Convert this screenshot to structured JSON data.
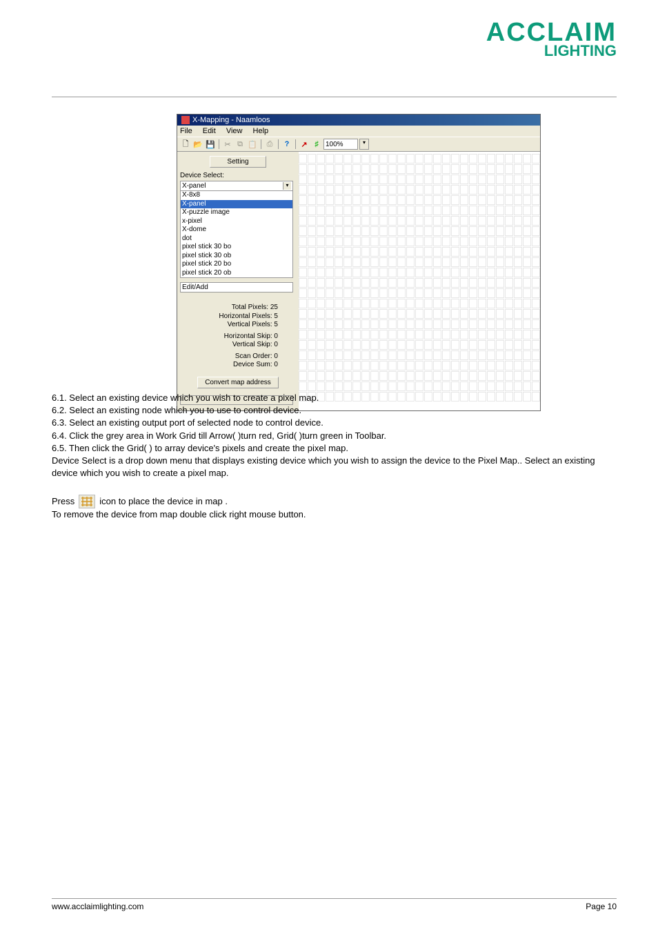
{
  "brand": {
    "name": "ACCLAIM",
    "sub": "LIGHTING"
  },
  "window": {
    "title": "X-Mapping - Naamloos",
    "menu": {
      "file": "File",
      "edit": "Edit",
      "view": "View",
      "help": "Help"
    },
    "toolbar": {
      "zoom": "100%"
    },
    "leftpanel": {
      "setting": "Setting",
      "deviceSelectLabel": "Device Select:",
      "selected": "X-panel",
      "devices": [
        "X-8x8",
        "X-panel",
        "X-puzzle image",
        "x-pixel",
        "X-dome",
        "dot",
        "pixel stick 30 bo",
        "pixel stick 30 ob",
        "pixel stick 20 bo",
        "pixel stick 20 ob"
      ],
      "editAdd": "Edit/Add",
      "stats": {
        "totalPixels": "Total Pixels: 25",
        "horizontalPixels": "Horizontal Pixels: 5",
        "verticalPixels": "Vertical Pixels: 5",
        "horizontalSkip": "Horizontal Skip: 0",
        "verticalSkip": "Vertical Skip: 0",
        "scanOrder": "Scan Order: 0",
        "deviceSum": "Device Sum: 0"
      },
      "convert": "Convert map address"
    }
  },
  "instructions": {
    "l1": "6.1. Select an existing device which you wish to create a pixel map.",
    "l2": "6.2. Select an existing node which you to use to control device.",
    "l3": "6.3. Select an existing output port of selected node to control device.",
    "l4": "6.4. Click the grey area in Work Grid till Arrow( )turn red, Grid( )turn green in Toolbar.",
    "l5": "6.5. Then click the Grid( ) to array device's pixels and create the pixel map.",
    "para2": "Device Select is a drop down menu that displays existing device which you wish to assign the device to the Pixel Map.. Select an existing device which you wish to create a pixel map.",
    "pressPrefix": "Press",
    "pressSuffix": "icon to place the device in map .",
    "para3": "To remove the device from map double click right mouse button."
  },
  "footer": {
    "url": "www.acclaimlighting.com",
    "page": "Page 10"
  }
}
